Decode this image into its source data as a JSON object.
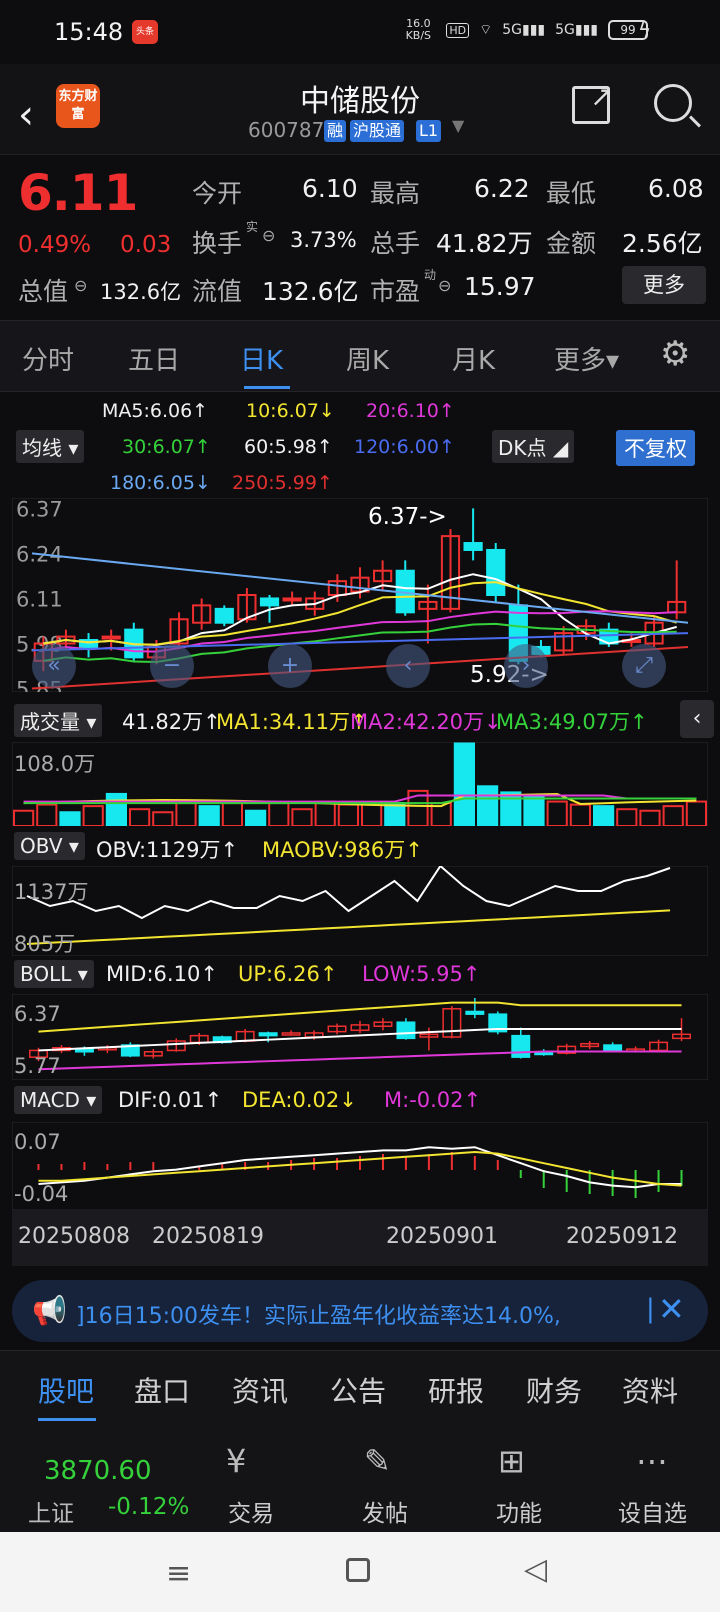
{
  "status": {
    "time": "15:48",
    "app_badge": "头条",
    "net_speed": "16.0 KB/S",
    "battery": "99"
  },
  "header": {
    "name": "中储股份",
    "code": "600787",
    "tags": [
      "融",
      "沪股通",
      "L1"
    ],
    "logo": "东方财富"
  },
  "quote": {
    "price": "6.11",
    "change_pct": "0.49%",
    "change": "0.03",
    "open_label": "今开",
    "open": "6.10",
    "high_label": "最高",
    "high": "6.22",
    "low_label": "最低",
    "low": "6.08",
    "turnover_label": "换手",
    "turnover_sup": "实",
    "turnover": "3.73%",
    "volume_label": "总手",
    "volume": "41.82万",
    "amount_label": "金额",
    "amount": "2.56亿",
    "mktcap_label": "总值",
    "mktcap": "132.6亿",
    "float_label": "流值",
    "float": "132.6亿",
    "pe_label": "市盈",
    "pe_sup": "动",
    "pe": "15.97",
    "more": "更多"
  },
  "ktabs": [
    "分时",
    "五日",
    "日K",
    "周K",
    "月K",
    "更多▾"
  ],
  "ma_legend": {
    "ma_btn": "均线",
    "ma5": "MA5:6.06↑",
    "ma10": "10:6.07↓",
    "ma20": "20:6.10↑",
    "ma30": "30:6.07↑",
    "ma60": "60:5.98↑",
    "ma120": "120:6.00↑",
    "ma180": "180:6.05↓",
    "ma250": "250:5.99↑",
    "dk": "DK点",
    "fq": "不复权"
  },
  "kline": {
    "y_labels": [
      "6.37",
      "6.24",
      "6.11",
      "5.98",
      "5.85"
    ],
    "max_note": "6.37->",
    "min_note": "5.92->",
    "candles": [
      [
        5.93,
        5.98,
        5.9,
        6.0
      ],
      [
        5.98,
        6.0,
        5.96,
        6.02
      ],
      [
        5.99,
        5.97,
        5.94,
        6.01
      ],
      [
        6.0,
        6.0,
        5.96,
        6.02
      ],
      [
        6.02,
        5.94,
        5.93,
        6.04
      ],
      [
        5.94,
        5.97,
        5.92,
        5.99
      ],
      [
        5.98,
        6.05,
        5.97,
        6.07
      ],
      [
        6.04,
        6.09,
        6.02,
        6.11
      ],
      [
        6.08,
        6.04,
        6.03,
        6.09
      ],
      [
        6.05,
        6.12,
        6.04,
        6.14
      ],
      [
        6.11,
        6.09,
        6.04,
        6.12
      ],
      [
        6.11,
        6.11,
        6.09,
        6.13
      ],
      [
        6.08,
        6.11,
        6.06,
        6.13
      ],
      [
        6.12,
        6.16,
        6.1,
        6.18
      ],
      [
        6.13,
        6.17,
        6.11,
        6.2
      ],
      [
        6.16,
        6.19,
        6.13,
        6.22
      ],
      [
        6.19,
        6.07,
        6.06,
        6.22
      ],
      [
        6.08,
        6.1,
        5.98,
        6.15
      ],
      [
        6.08,
        6.29,
        6.07,
        6.31
      ],
      [
        6.27,
        6.25,
        6.22,
        6.37
      ],
      [
        6.25,
        6.12,
        6.1,
        6.27
      ],
      [
        6.09,
        5.93,
        5.92,
        6.15
      ],
      [
        5.97,
        5.95,
        5.94,
        5.99
      ],
      [
        5.96,
        6.01,
        5.95,
        6.03
      ],
      [
        6.01,
        6.03,
        5.99,
        6.05
      ],
      [
        6.02,
        5.98,
        5.97,
        6.04
      ],
      [
        5.99,
        5.99,
        5.97,
        6.01
      ],
      [
        5.98,
        6.04,
        5.97,
        6.06
      ],
      [
        6.07,
        6.1,
        6.05,
        6.22
      ]
    ],
    "x_labels": [
      "20250808",
      "20250819",
      "20250901",
      "20250912"
    ]
  },
  "volume": {
    "btn": "成交量",
    "v": "41.82万↑",
    "ma1": "MA1:34.11万↑",
    "ma2": "MA2:42.20万↓",
    "ma3": "MA3:49.07万↑",
    "y_label": "108.0万",
    "bars": [
      20,
      28,
      18,
      26,
      42,
      22,
      18,
      30,
      26,
      30,
      20,
      30,
      22,
      32,
      28,
      28,
      30,
      46,
      30,
      108,
      52,
      44,
      38,
      32,
      28,
      26,
      22,
      20,
      26,
      32
    ]
  },
  "obv": {
    "btn": "OBV",
    "v": "OBV:1129万↑",
    "ma": "MAOBV:986万↑",
    "y_top": "1137万",
    "y_bot": "805万"
  },
  "boll": {
    "btn": "BOLL",
    "mid": "MID:6.10↑",
    "up": "UP:6.26↑",
    "low": "LOW:5.95↑",
    "y_top": "6.37",
    "y_bot": "5.77"
  },
  "macd": {
    "btn": "MACD",
    "dif": "DIF:0.01↑",
    "dea": "DEA:0.02↓",
    "m": "M:-0.02↑",
    "y_top": "0.07",
    "y_bot": "-0.04"
  },
  "banner": {
    "text": "]16日15:00发车！实际止盈年化收益率达14.0%,",
    "sep": "|"
  },
  "bottom_tabs": [
    "股吧",
    "盘口",
    "资讯",
    "公告",
    "研报",
    "财务",
    "资料"
  ],
  "bottom_nav": {
    "index_value": "3870.60",
    "index_name": "上证",
    "index_change": "-0.12%",
    "items": [
      "交易",
      "发帖",
      "功能",
      "设自选"
    ]
  },
  "colors": {
    "up": "#ef2f2f",
    "down": "#17e8f0",
    "accent": "#3d8ff0",
    "yellow": "#f2e430",
    "magenta": "#e038d8",
    "green": "#35d13b"
  }
}
